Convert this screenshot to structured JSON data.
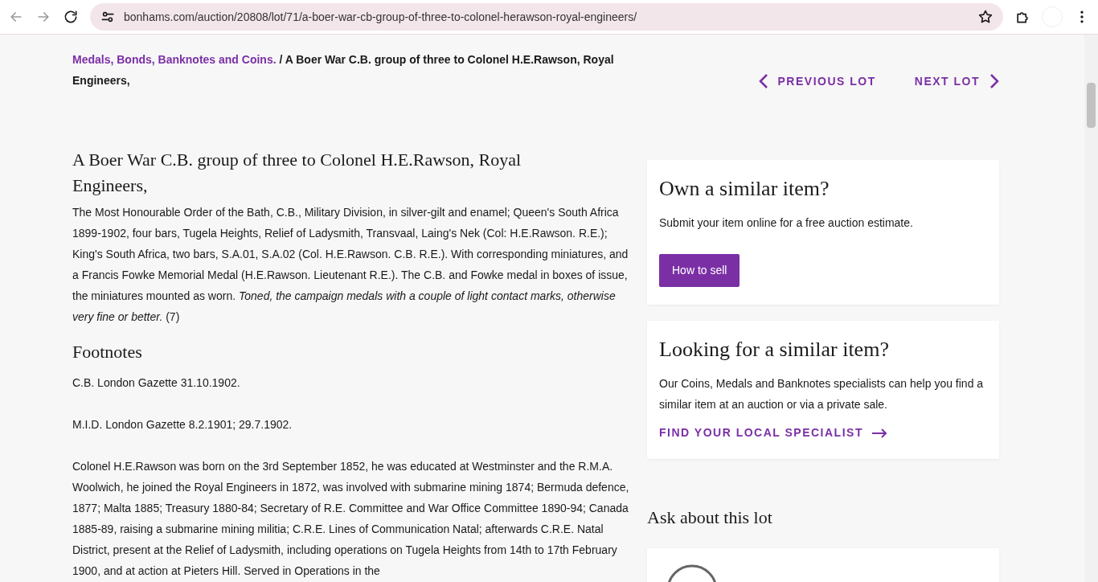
{
  "browser": {
    "url": "bonhams.com/auction/20808/lot/71/a-boer-war-cb-group-of-three-to-colonel-herawson-royal-engineers/"
  },
  "breadcrumb": {
    "link": "Medals, Bonds, Banknotes and Coins.",
    "separator": "/",
    "current": "A Boer War C.B. group of three to Colonel H.E.Rawson, Royal Engineers,"
  },
  "lot_nav": {
    "previous": "PREVIOUS LOT",
    "next": "NEXT LOT"
  },
  "lot": {
    "title": "A Boer War C.B. group of three to Colonel H.E.Rawson, Royal Engineers,",
    "description": "The Most Honourable Order of the Bath, C.B., Military Division, in silver-gilt and enamel; Queen's South Africa 1899-1902, four bars, Tugela Heights, Relief of Ladysmith, Transvaal, Laing's Nek (Col: H.E.Rawson. R.E.); King's South Africa, two bars, S.A.01, S.A.02 (Col. H.E.Rawson. C.B. R.E.). With corresponding miniatures, and a Francis Fowke Memorial Medal (H.E.Rawson. Lieutenant R.E.). The C.B. and Fowke medal in boxes of issue, the miniatures mounted as worn. *Toned, the campaign medals with a couple of light contact marks, otherwise very fine or better.* (7)",
    "footnotes_heading": "Footnotes",
    "footnotes": [
      "C.B. London Gazette 31.10.1902.",
      "M.I.D. London Gazette 8.2.1901; 29.7.1902.",
      "Colonel H.E.Rawson was born on the 3rd September 1852, he was educated at Westminster and the R.M.A. Woolwich, he joined the Royal Engineers in 1872, was involved with submarine mining 1874; Bermuda defence, 1877; Malta 1885; Treasury 1880-84; Secretary of R.E. Committee and War Office Committee 1890-94; Canada 1885-89, raising a submarine mining militia; C.R.E. Lines of Communication Natal; afterwards C.R.E. Natal District, present at the Relief of Ladysmith, including operations on Tugela Heights from 14th to 17th February 1900, and at action at Pieters Hill. Served in Operations in the"
    ]
  },
  "sidebar": [
    {
      "kind": "button",
      "title": "Own a similar item?",
      "text": "Submit your item online for a free auction estimate.",
      "action": "How to sell"
    },
    {
      "kind": "link",
      "title": "Looking for a similar item?",
      "text": "Our Coins, Medals and Banknotes specialists can help you find a similar item at an auction or via a private sale.",
      "action": "FIND YOUR LOCAL SPECIALIST"
    }
  ],
  "ask": {
    "title": "Ask about this lot"
  }
}
